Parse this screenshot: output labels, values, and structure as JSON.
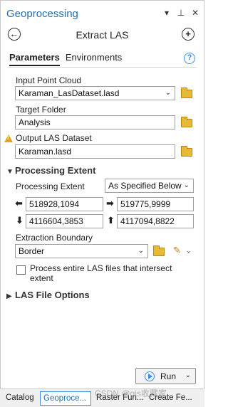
{
  "pane": {
    "title": "Geoprocessing",
    "icons": [
      "chevron-down-icon",
      "pin-icon",
      "close-icon"
    ]
  },
  "tool": {
    "title": "Extract LAS",
    "back_icon": "back-arrow-icon",
    "add_icon": "add-icon"
  },
  "tabs": {
    "parameters": "Parameters",
    "environments": "Environments",
    "help_glyph": "?"
  },
  "params": {
    "input_point_cloud": {
      "label": "Input Point Cloud",
      "value": "Karaman_LasDataset.lasd"
    },
    "target_folder": {
      "label": "Target Folder",
      "value": "Analysis"
    },
    "output_las_dataset": {
      "label": "Output LAS Dataset",
      "value": "Karaman.lasd"
    }
  },
  "processing_extent": {
    "section_label": "Processing Extent",
    "label": "Processing Extent",
    "selected": "As Specified Below",
    "left": "518928,1094",
    "right": "519775,9999",
    "bottom": "4116604,3853",
    "top": "4117094,8822"
  },
  "extraction_boundary": {
    "label": "Extraction Boundary",
    "selected": "Border"
  },
  "checkbox": {
    "label": "Process entire LAS files that intersect extent",
    "checked": false
  },
  "las_file_options": {
    "section_label": "LAS File Options"
  },
  "run": {
    "label": "Run"
  },
  "bottom_tabs": [
    "Catalog",
    "Geoproce...",
    "Raster Fun...",
    "Create Fe..."
  ],
  "watermark": "CSDN @gis收藏家",
  "colors": {
    "accent": "#1f6fb2",
    "folder": "#e8b934",
    "warning": "#e8a317"
  }
}
